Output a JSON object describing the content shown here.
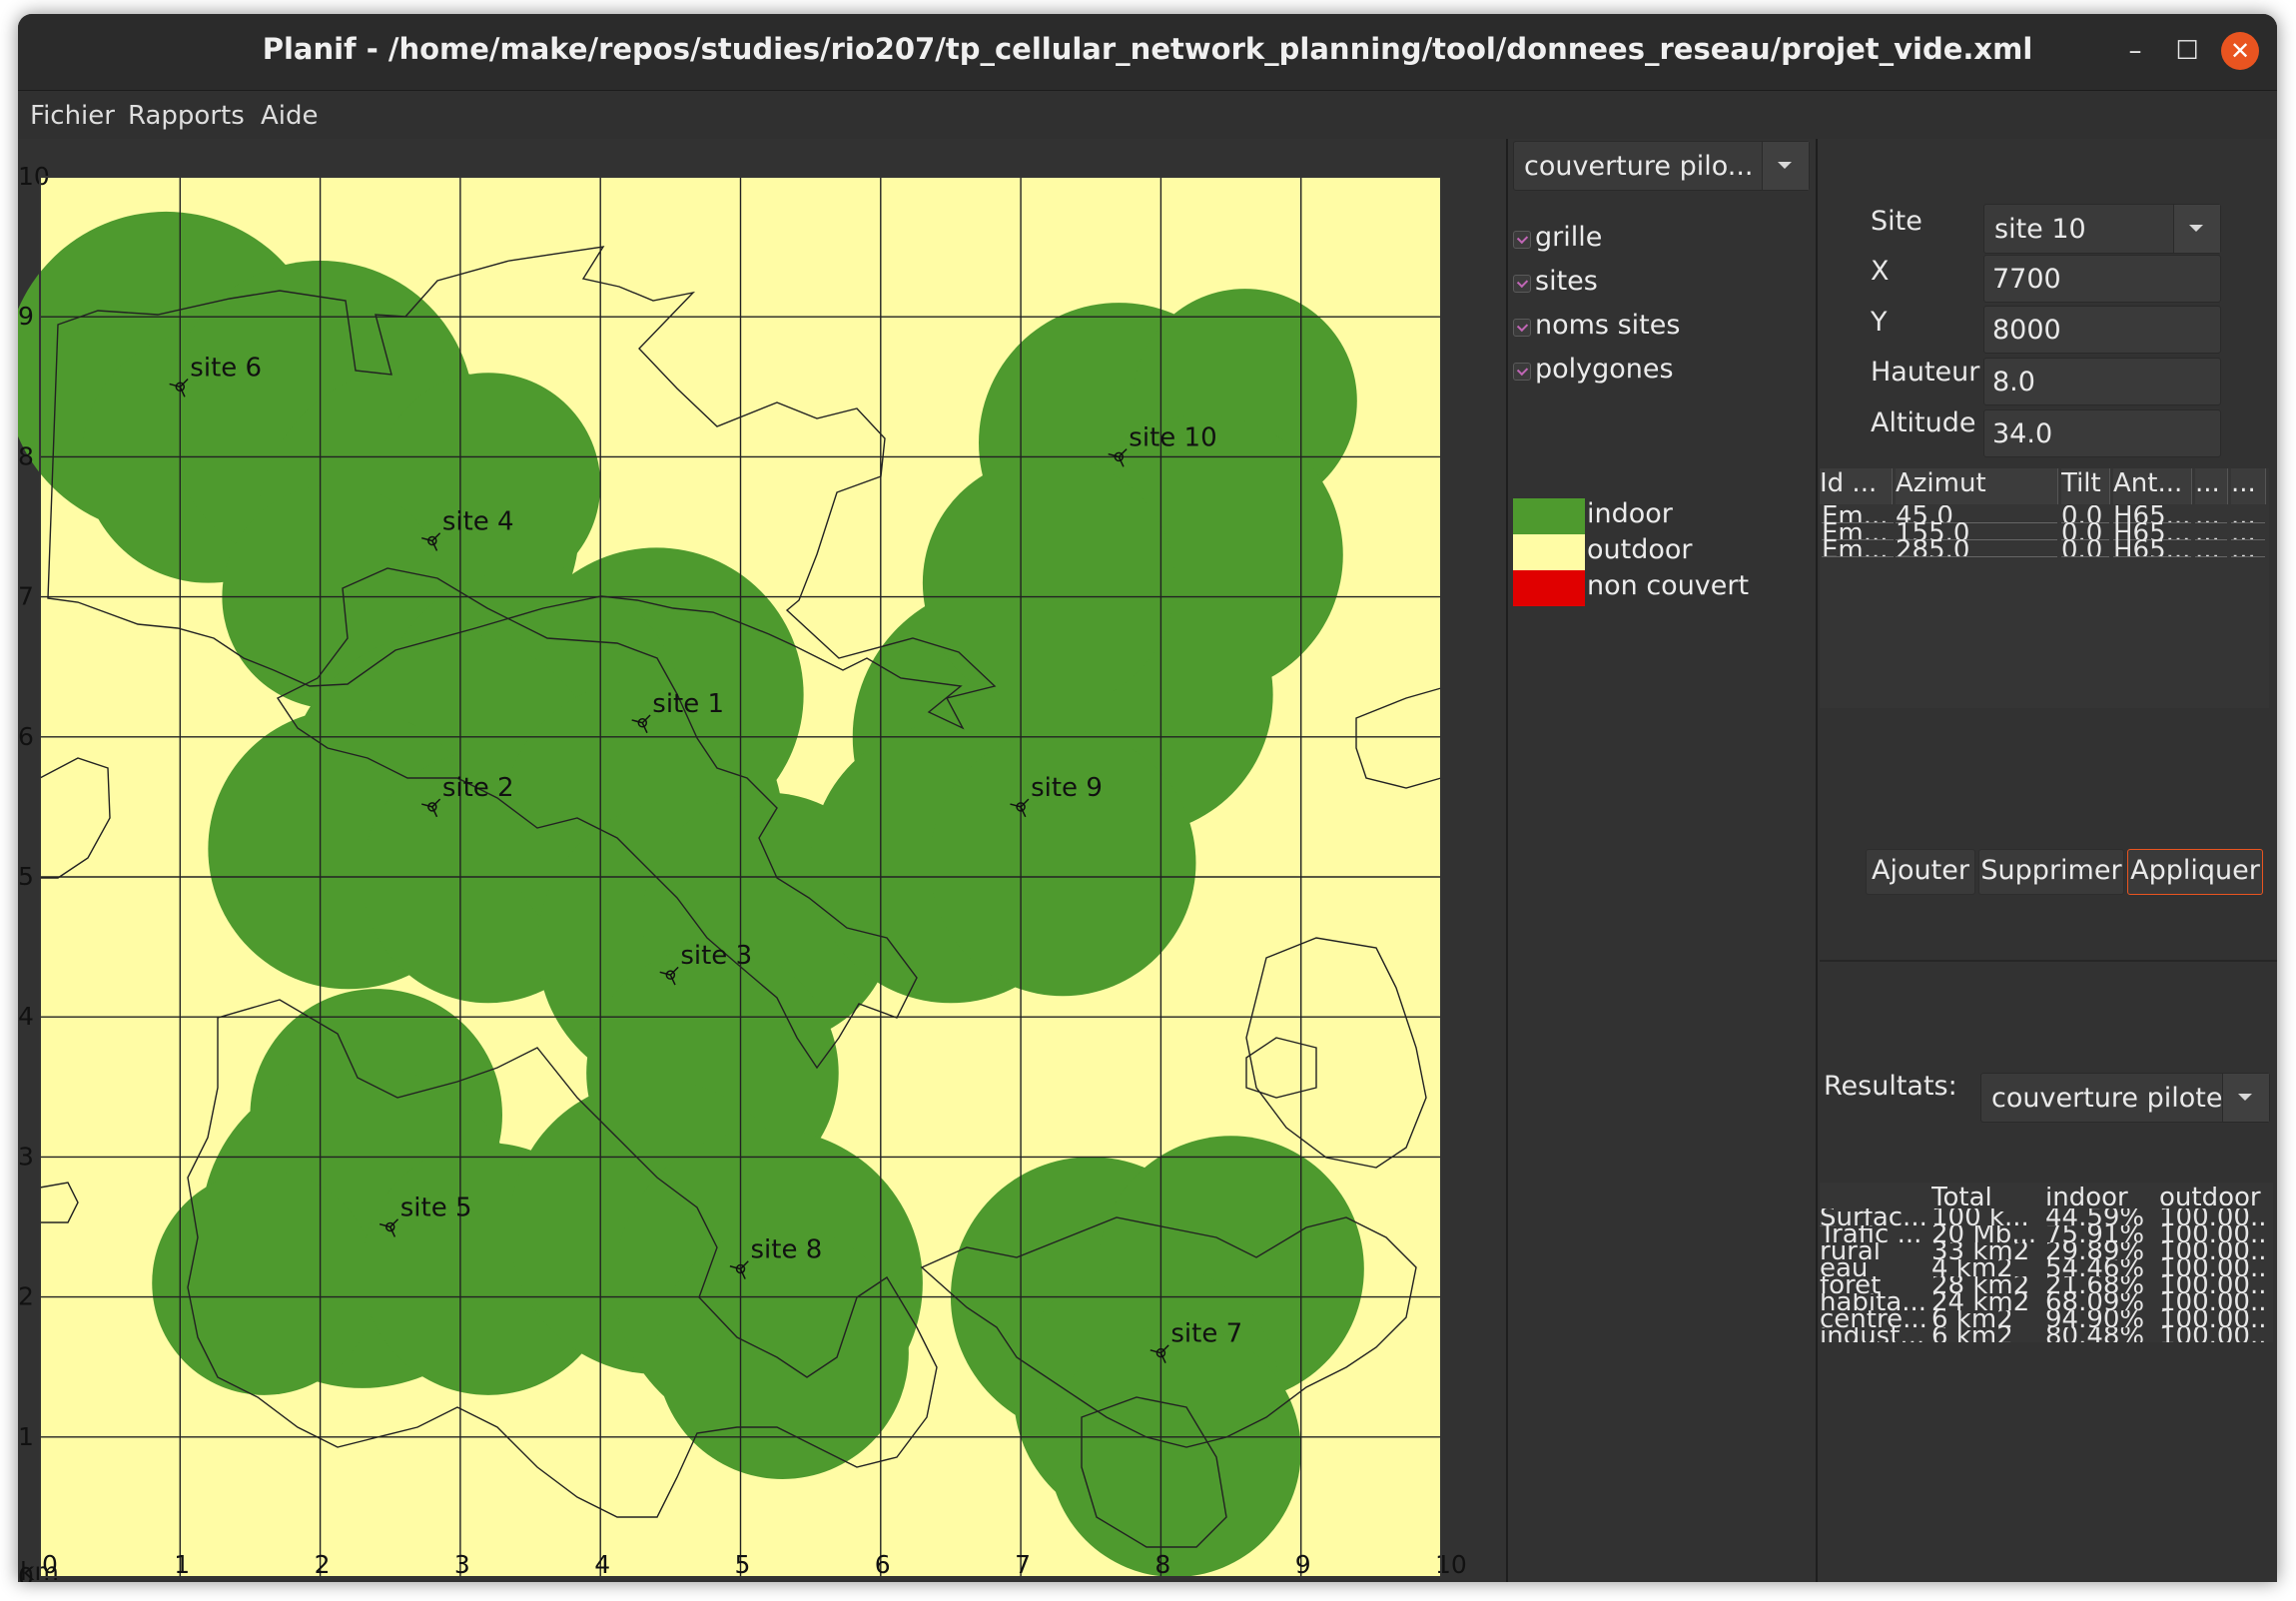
{
  "window": {
    "title": "Planif - /home/make/repos/studies/rio207/tp_cellular_network_planning/tool/donnees_reseau/projet_vide.xml",
    "minimize": "–",
    "maximize": "☐",
    "close": "✕"
  },
  "menu": [
    "Fichier",
    "Rapports",
    "Aide"
  ],
  "map": {
    "x_ticks": [
      "0",
      "1",
      "2",
      "3",
      "4",
      "5",
      "6",
      "7",
      "8",
      "9",
      "10"
    ],
    "y_ticks": [
      "0",
      "1",
      "2",
      "3",
      "4",
      "5",
      "6",
      "7",
      "8",
      "9",
      "10"
    ],
    "unit": "km",
    "colors": {
      "indoor": "#4e9a2e",
      "outdoor": "#fffca5",
      "non_couvert": "#e00000"
    },
    "sites": [
      {
        "name": "site 1",
        "x": 4.3,
        "y": 6.1
      },
      {
        "name": "site 2",
        "x": 2.8,
        "y": 5.5
      },
      {
        "name": "site 3",
        "x": 4.5,
        "y": 4.3
      },
      {
        "name": "site 4",
        "x": 2.8,
        "y": 7.4
      },
      {
        "name": "site 5",
        "x": 2.5,
        "y": 2.5
      },
      {
        "name": "site 6",
        "x": 1.0,
        "y": 8.5
      },
      {
        "name": "site 7",
        "x": 8.0,
        "y": 1.6
      },
      {
        "name": "site 8",
        "x": 5.0,
        "y": 2.2
      },
      {
        "name": "site 9",
        "x": 7.0,
        "y": 5.5
      },
      {
        "name": "site 10",
        "x": 7.7,
        "y": 8.0
      }
    ]
  },
  "view_combo": "couverture pilo...",
  "checks": [
    "grille",
    "sites",
    "noms sites",
    "polygones"
  ],
  "legend": [
    {
      "label": "indoor",
      "color": "#4e9a2e"
    },
    {
      "label": "outdoor",
      "color": "#fffca5"
    },
    {
      "label": "non couvert",
      "color": "#e00000"
    }
  ],
  "site_form": {
    "site_label": "Site",
    "site_value": "site 10",
    "x_label": "X",
    "x_value": "7700",
    "y_label": "Y",
    "y_value": "8000",
    "hauteur_label": "Hauteur",
    "hauteur_value": "8.0",
    "altitude_label": "Altitude",
    "altitude_value": "34.0"
  },
  "antenna_table": {
    "headers": [
      "Id ...",
      "Azimut",
      "Tilt",
      "Ant...",
      "...",
      "..."
    ],
    "rows": [
      [
        "Em...",
        "45.0",
        "0.0",
        "H65...",
        "...",
        "..."
      ],
      [
        "Em...",
        "155.0",
        "0.0",
        "H65...",
        "...",
        "..."
      ],
      [
        "Em...",
        "285.0",
        "0.0",
        "H65...",
        "...",
        "..."
      ]
    ]
  },
  "buttons": {
    "add": "Ajouter",
    "remove": "Supprimer",
    "apply": "Appliquer"
  },
  "results": {
    "label": "Resultats:",
    "combo": "couverture pilote",
    "headers": [
      "Total",
      "indoor",
      "outdoor"
    ],
    "rows": [
      [
        "Surfac...",
        "100 k...",
        "44.59%",
        "100.00..."
      ],
      [
        "Trafic ...",
        "20 Mb...",
        "75.91%",
        "100.00..."
      ],
      [
        "rural",
        "33 km2",
        "29.89%",
        "100.00..."
      ],
      [
        "eau",
        "4 km2",
        "54.46%",
        "100.00..."
      ],
      [
        "foret",
        "28 km2",
        "21.68%",
        "100.00..."
      ],
      [
        "habita...",
        "24 km2",
        "68.09%",
        "100.00..."
      ],
      [
        "centre...",
        "6 km2",
        "94.90%",
        "100.00..."
      ],
      [
        "indust...",
        "6 km2",
        "80.48%",
        "100.00..."
      ]
    ]
  }
}
